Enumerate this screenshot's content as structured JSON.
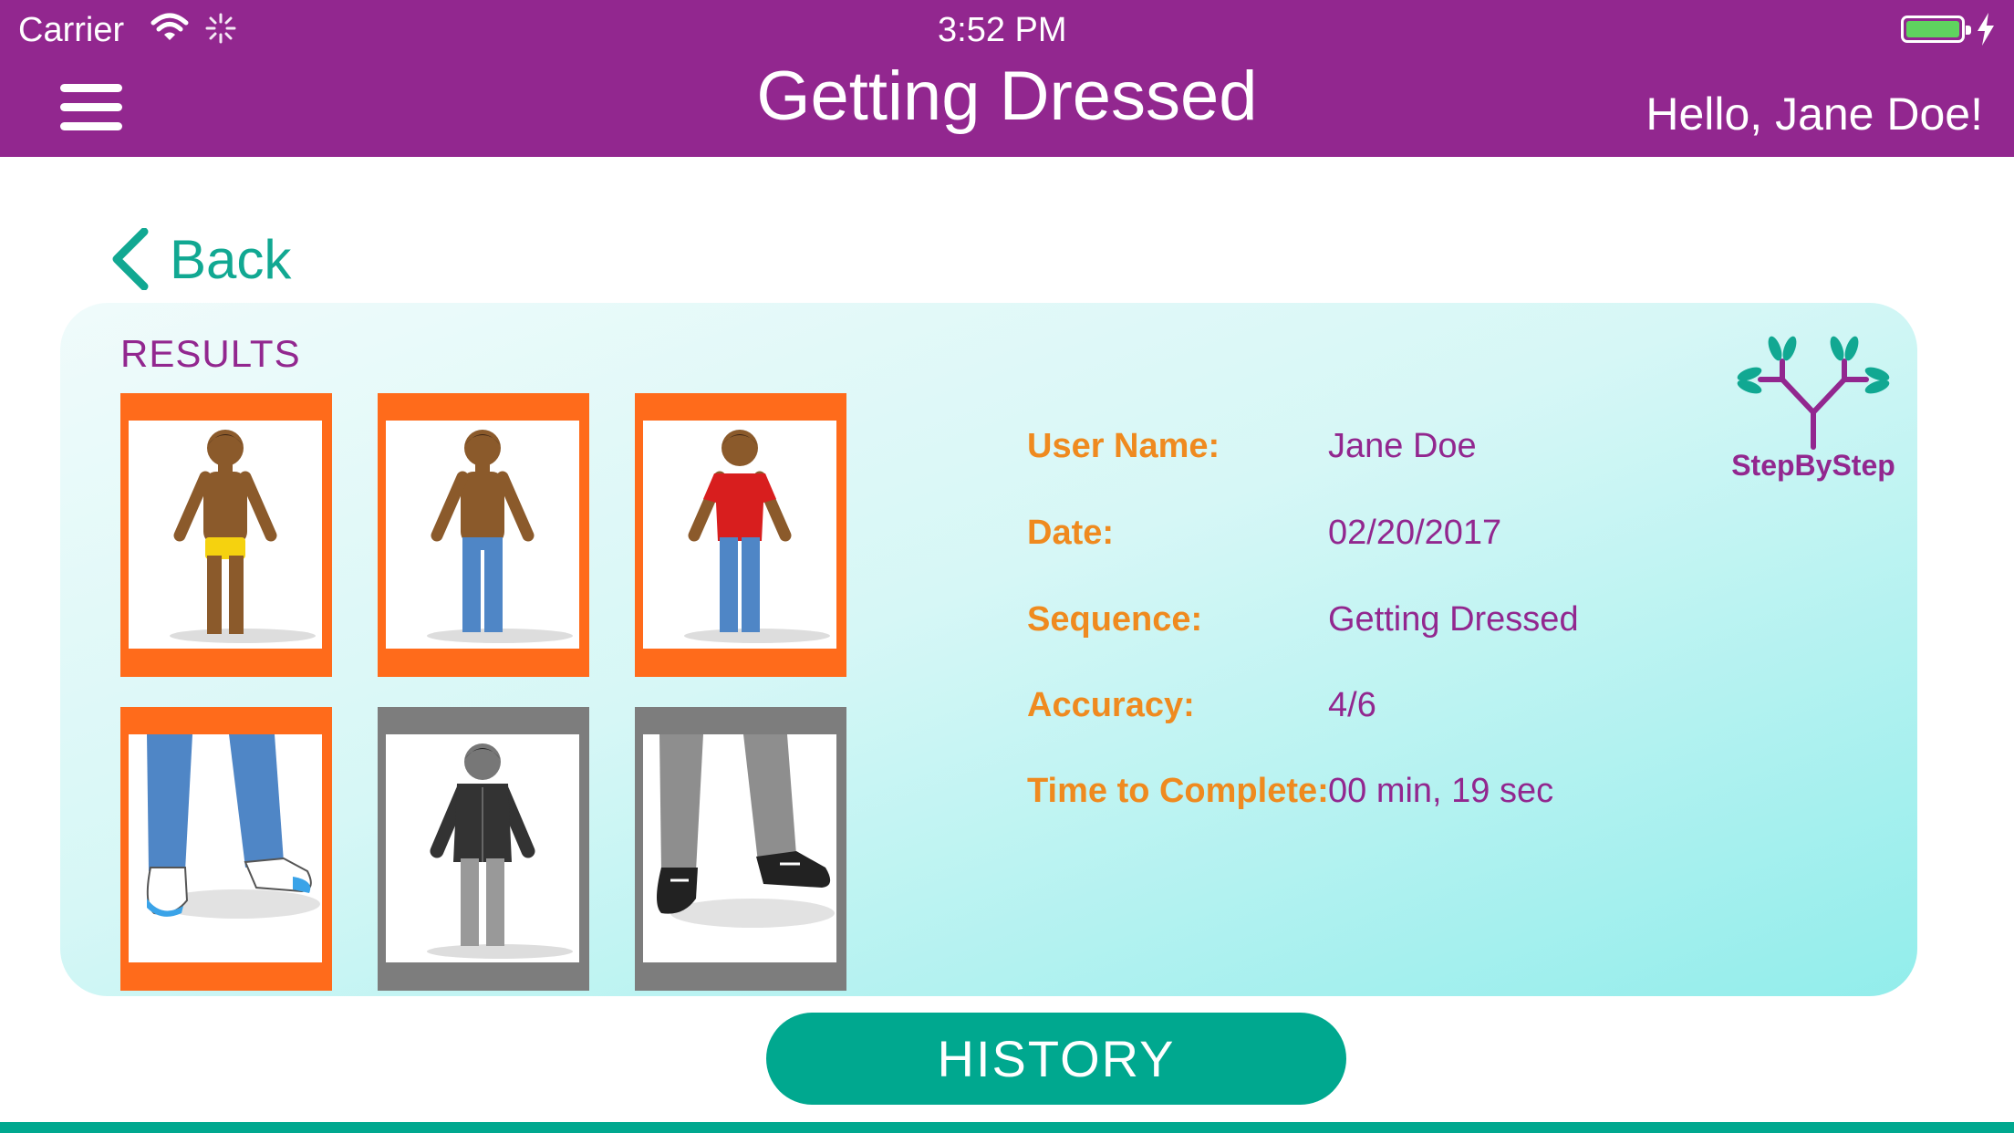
{
  "status_bar": {
    "carrier": "Carrier",
    "time": "3:52 PM"
  },
  "header": {
    "title": "Getting Dressed",
    "greeting": "Hello, Jane Doe!"
  },
  "nav": {
    "back_label": "Back"
  },
  "results": {
    "heading": "RESULTS",
    "tiles": [
      {
        "icon": "boy-in-underwear",
        "state": "correct"
      },
      {
        "icon": "boy-in-jeans",
        "state": "correct"
      },
      {
        "icon": "boy-in-red-shirt",
        "state": "correct"
      },
      {
        "icon": "feet-in-socks",
        "state": "correct"
      },
      {
        "icon": "boy-in-hoodie",
        "state": "incorrect"
      },
      {
        "icon": "feet-in-shoes",
        "state": "incorrect"
      }
    ]
  },
  "details": {
    "user_name_label": "User Name:",
    "user_name": "Jane Doe",
    "date_label": "Date:",
    "date": "02/20/2017",
    "sequence_label": "Sequence:",
    "sequence": "Getting Dressed",
    "accuracy_label": "Accuracy:",
    "accuracy": "4/6",
    "time_label": "Time to Complete:",
    "time": "00 min, 19 sec"
  },
  "logo": {
    "text": "StepByStep"
  },
  "actions": {
    "history_label": "HISTORY"
  },
  "colors": {
    "brand_purple": "#92278f",
    "accent_teal": "#00a88f",
    "label_orange": "#ef8a1f",
    "tile_orange": "#ff6b1b",
    "tile_gray": "#7d7d7d"
  }
}
